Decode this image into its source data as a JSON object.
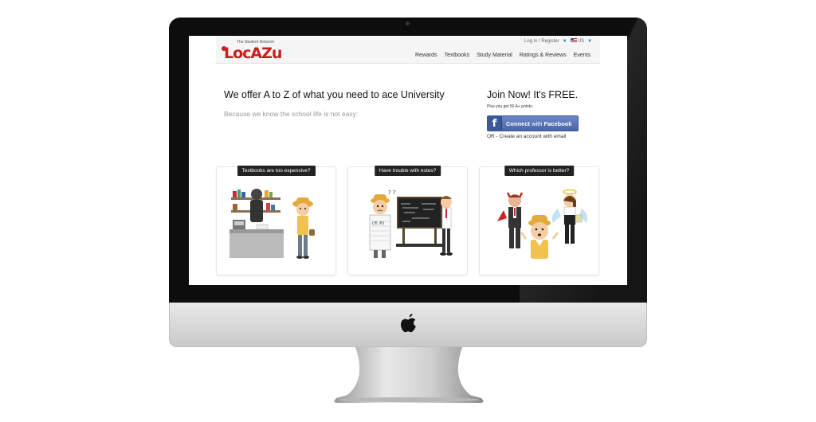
{
  "site": {
    "logo_tagline": "The Student Network",
    "logo_text": "LocAZu",
    "top_links": {
      "login": "Log in / Register",
      "locale": "US"
    },
    "nav": [
      "Rewards",
      "Textbooks",
      "Study Material",
      "Ratings & Reviews",
      "Events"
    ]
  },
  "hero": {
    "headline": "We offer A to Z of what you need to ace University",
    "subline": "Because we know the school life is not easy:"
  },
  "signup": {
    "title": "Join Now! It's FREE.",
    "subtitle": "Plus you get 50 A+ points.",
    "facebook_button": {
      "icon": "f",
      "prefix": "Connect",
      "middle": " with ",
      "brand": "Facebook"
    },
    "or_create": "OR - Create an account with email"
  },
  "cards": [
    {
      "label": "Textbooks are too expensive?",
      "illustration": "bookstore-cashier-illustration"
    },
    {
      "label": "Have trouble with notes?",
      "illustration": "confused-student-chalkboard-illustration"
    },
    {
      "label": "Which professor is better?",
      "illustration": "devil-angel-professors-illustration"
    }
  ],
  "colors": {
    "brand_red": "#c91e1e",
    "facebook_blue": "#3b5998",
    "label_dark": "#222222"
  }
}
